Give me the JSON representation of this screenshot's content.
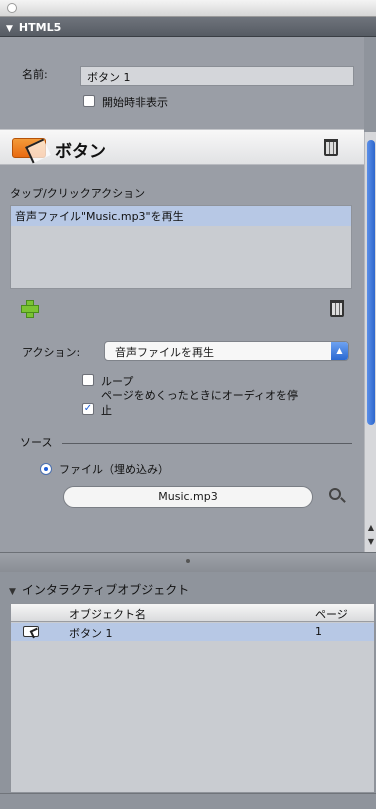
{
  "panel": {
    "section_title": "HTML5",
    "name_label": "名前:",
    "name_value": "ボタン 1",
    "hide_at_start_label": "開始時非表示",
    "hide_at_start_checked": false
  },
  "object": {
    "title": "ボタン"
  },
  "actions": {
    "list_title": "タップ/クリックアクション",
    "items": [
      "音声ファイル\"Music.mp3\"を再生"
    ],
    "action_label": "アクション:",
    "action_value": "音声ファイルを再生",
    "loop_label": "ループ",
    "loop_checked": false,
    "stop_label": "ページをめくったときにオーディオを停止",
    "stop_checked": true
  },
  "source": {
    "label": "ソース",
    "option_label": "ファイル（埋め込み）",
    "file_name": "Music.mp3"
  },
  "interactive": {
    "title": "インタラクティブオブジェクト",
    "columns": [
      "オブジェクト名",
      "ページ"
    ],
    "rows": [
      {
        "name": "ボタン 1",
        "page": "1"
      }
    ]
  }
}
